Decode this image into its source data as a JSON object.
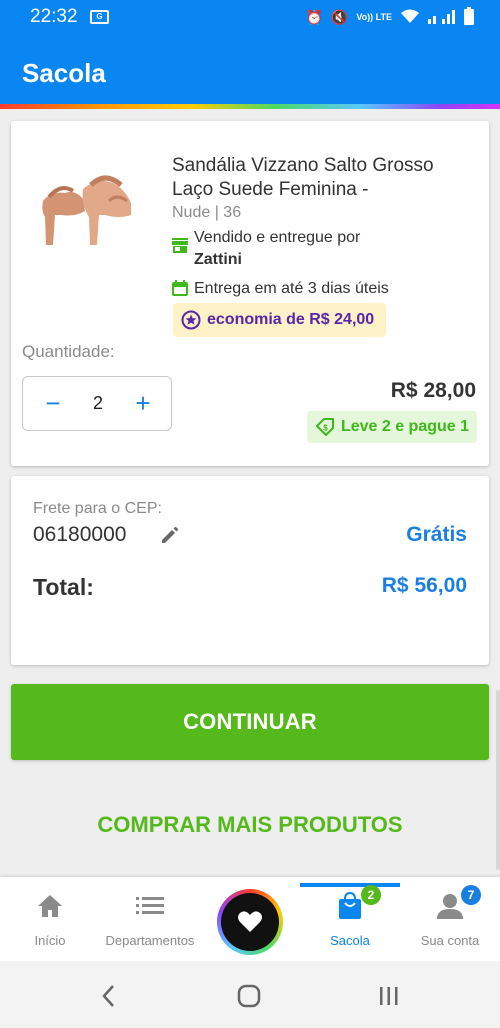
{
  "status_bar": {
    "time": "22:32",
    "network": "Vo)) LTE"
  },
  "header": {
    "title": "Sacola"
  },
  "product": {
    "name": "Sandália Vizzano Salto Grosso Laço Suede Feminina -",
    "variant": "Nude | 36",
    "seller_prefix": "Vendido e entregue por",
    "seller_name": "Zattini",
    "delivery": "Entrega em até 3 dias úteis",
    "savings": "economia de R$ 24,00",
    "quantity_label": "Quantidade:",
    "quantity": "2",
    "minus_label": "−",
    "plus_label": "+",
    "price": "R$ 28,00",
    "promo": "Leve 2 e pague 1"
  },
  "shipping": {
    "cep_label": "Frete para o CEP:",
    "cep": "06180000",
    "freight": "Grátis",
    "total_label": "Total:",
    "total": "R$ 56,00"
  },
  "actions": {
    "continue": "CONTINUAR",
    "more": "COMPRAR MAIS PRODUTOS"
  },
  "bottom_nav": {
    "home": "Início",
    "departments": "Departamentos",
    "bag": "Sacola",
    "bag_count": "2",
    "account": "Sua conta",
    "account_count": "7"
  },
  "colors": {
    "primary": "#0a86f2",
    "green": "#55b91b",
    "purple": "#5a25a8",
    "savings_bg": "#fdf1c8",
    "promo_bg": "#e5f7da"
  },
  "icons": [
    "home-icon",
    "menu-list-icon",
    "heart-icon",
    "bag-icon",
    "user-icon",
    "store-icon",
    "calendar-icon",
    "star-circle-icon",
    "tag-icon",
    "pencil-icon"
  ]
}
